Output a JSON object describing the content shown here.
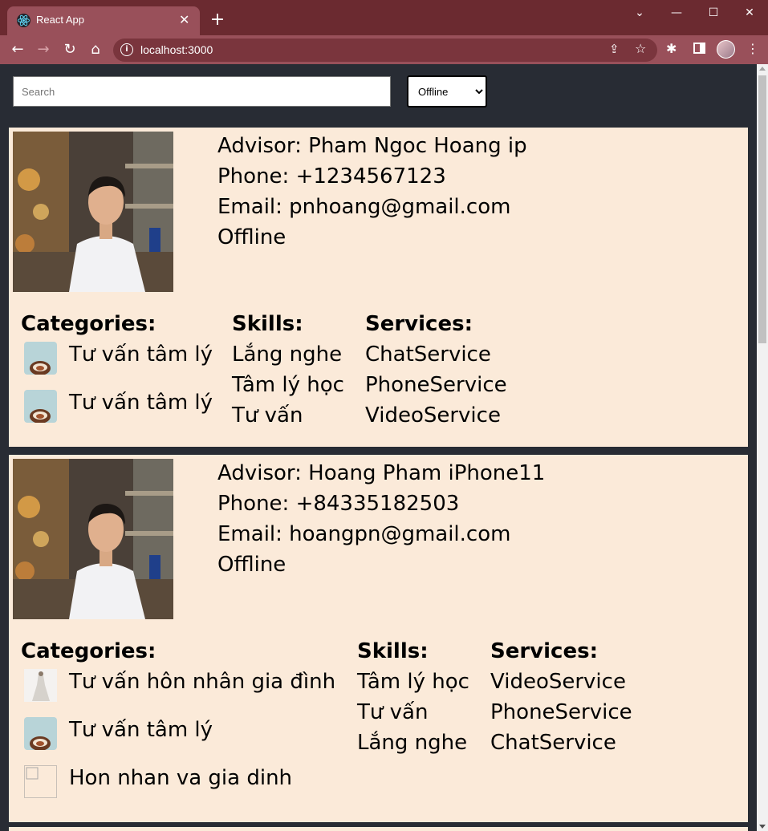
{
  "browser": {
    "tab_title": "React App",
    "url": "localhost:3000"
  },
  "search": {
    "placeholder": "Search",
    "value": ""
  },
  "status_filter": {
    "selected": "Offline"
  },
  "advisors": [
    {
      "name_line": "Advisor: Pham Ngoc Hoang ip",
      "phone_line": "Phone: +1234567123",
      "email_line": "Email: pnhoang@gmail.com",
      "status": "Offline",
      "categories_title": "Categories:",
      "categories": [
        {
          "label": "Tư vấn tâm lý",
          "thumb": "coffee-image"
        },
        {
          "label": "Tư vấn tâm lý",
          "thumb": "coffee-image"
        }
      ],
      "skills_title": "Skills:",
      "skills": [
        "Lắng nghe",
        "Tâm lý học",
        "Tư vấn"
      ],
      "services_title": "Services:",
      "services": [
        "ChatService",
        "PhoneService",
        "VideoService"
      ]
    },
    {
      "name_line": "Advisor: Hoang Pham iPhone11",
      "phone_line": "Phone: +84335182503",
      "email_line": "Email: hoangpn@gmail.com",
      "status": "Offline",
      "categories_title": "Categories:",
      "categories": [
        {
          "label": "Tư vấn hôn nhân gia đình",
          "thumb": "wedding-image"
        },
        {
          "label": "Tư vấn tâm lý",
          "thumb": "coffee-image"
        },
        {
          "label": "Hon nhan va gia dinh",
          "thumb": "broken-image"
        }
      ],
      "skills_title": "Skills:",
      "skills": [
        "Tâm lý học",
        "Tư vấn",
        "Lắng nghe"
      ],
      "services_title": "Services:",
      "services": [
        "VideoService",
        "PhoneService",
        "ChatService"
      ]
    }
  ],
  "colors": {
    "titlebar": "#6b2a30",
    "toolbar": "#99505a",
    "page_bg": "#282c34",
    "card_bg": "#fbead9"
  }
}
